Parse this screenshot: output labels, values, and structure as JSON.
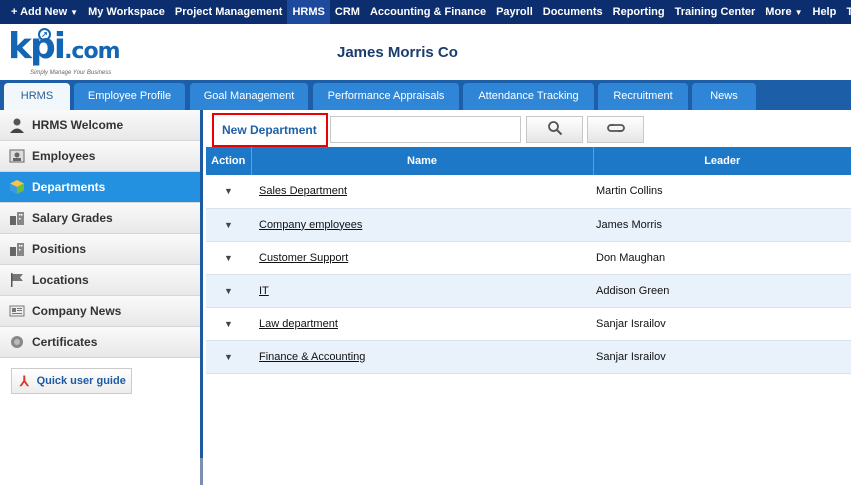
{
  "topnav": {
    "items": [
      {
        "label": "+ Add New",
        "caret": true
      },
      {
        "label": "My Workspace"
      },
      {
        "label": "Project Management"
      },
      {
        "label": "HRMS",
        "active": true
      },
      {
        "label": "CRM"
      },
      {
        "label": "Accounting & Finance"
      },
      {
        "label": "Payroll"
      },
      {
        "label": "Documents"
      },
      {
        "label": "Reporting"
      },
      {
        "label": "Training Center"
      },
      {
        "label": "More",
        "caret": true
      },
      {
        "label": "Help"
      },
      {
        "label": "Timer"
      }
    ]
  },
  "header": {
    "logo_text": "kpi",
    "logo_suffix": ".com",
    "logo_tagline": "Simply Manage Your Business",
    "company": "James Morris Co"
  },
  "tabs": [
    {
      "label": "HRMS",
      "active": true
    },
    {
      "label": "Employee Profile"
    },
    {
      "label": "Goal Management"
    },
    {
      "label": "Performance Appraisals"
    },
    {
      "label": "Attendance Tracking"
    },
    {
      "label": "Recruitment"
    },
    {
      "label": "News"
    }
  ],
  "sidebar": {
    "items": [
      {
        "label": "HRMS Welcome",
        "icon": "person-icon"
      },
      {
        "label": "Employees",
        "icon": "employees-icon"
      },
      {
        "label": "Departments",
        "icon": "cube-icon",
        "active": true
      },
      {
        "label": "Salary Grades",
        "icon": "building-icon"
      },
      {
        "label": "Positions",
        "icon": "building-icon"
      },
      {
        "label": "Locations",
        "icon": "flag-icon"
      },
      {
        "label": "Company News",
        "icon": "news-icon"
      },
      {
        "label": "Certificates",
        "icon": "badge-icon"
      }
    ],
    "guide_label": "Quick user guide"
  },
  "toolbar": {
    "new_department": "New Department",
    "search_value": ""
  },
  "table": {
    "headers": {
      "action": "Action",
      "name": "Name",
      "leader": "Leader"
    },
    "rows": [
      {
        "name": "Sales Department",
        "leader": "Martin Collins"
      },
      {
        "name": "Company employees",
        "leader": "James Morris"
      },
      {
        "name": "Customer Support",
        "leader": "Don Maughan"
      },
      {
        "name": "IT",
        "leader": "Addison Green"
      },
      {
        "name": "Law department",
        "leader": "Sanjar Israilov"
      },
      {
        "name": "Finance & Accounting",
        "leader": "Sanjar Israilov"
      }
    ]
  }
}
